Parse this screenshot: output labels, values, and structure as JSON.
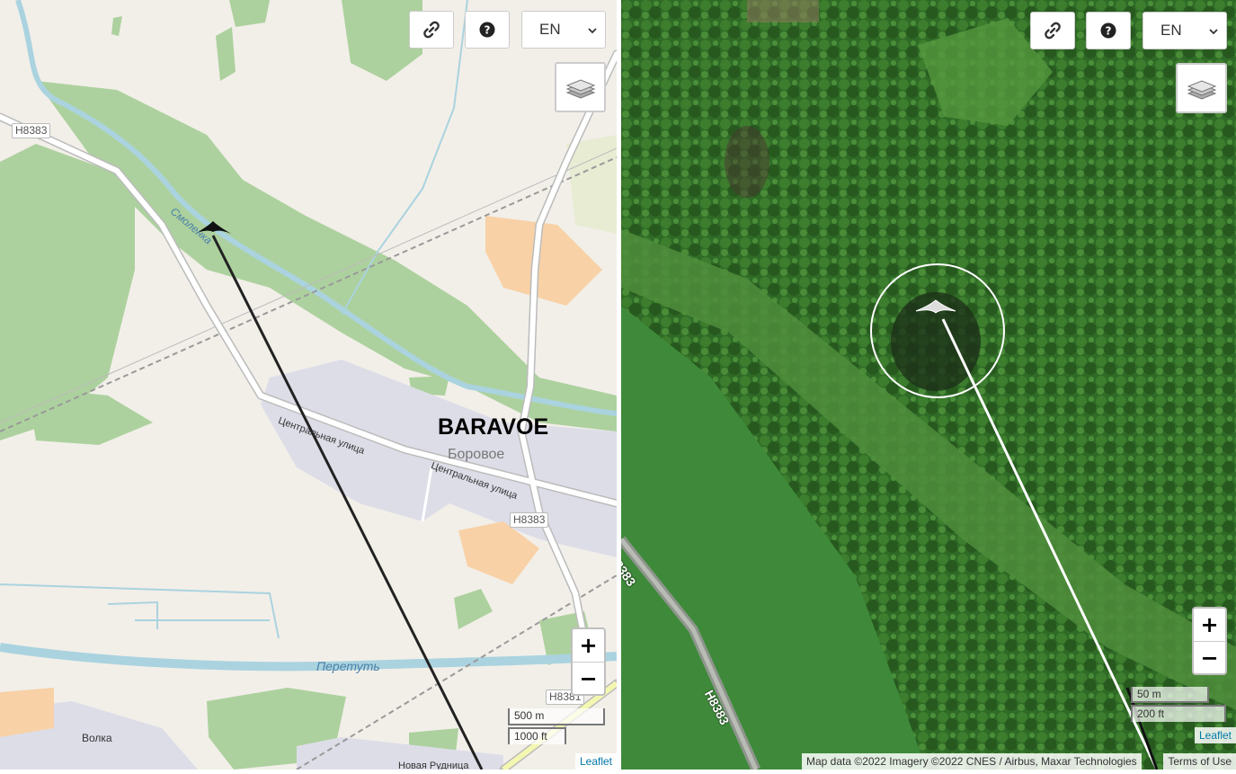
{
  "controls": {
    "left": {
      "lang": "EN",
      "zoom_in": "+",
      "zoom_out": "−"
    },
    "right": {
      "lang": "EN",
      "zoom_in": "+",
      "zoom_out": "−"
    }
  },
  "left_map": {
    "place_label": "BARAVOE",
    "place_label_ru": "Боровое",
    "road_badges": [
      "Н8383",
      "Н8383",
      "Н8381"
    ],
    "street_1": "Центральная улица",
    "street_2": "Центральная улица",
    "river_1": "Смоленка",
    "river_2": "Перетуть",
    "village": "Волка",
    "bottom_street": "Новая Рудница",
    "scale_metric": "500 m",
    "scale_imperial": "1000 ft",
    "attribution": "Leaflet"
  },
  "right_map": {
    "road_label_1": "Н8383",
    "road_label_2": "Н8383",
    "scale_metric": "50 m",
    "scale_imperial": "200 ft",
    "attribution_leaflet": "Leaflet",
    "attribution_data": "Map data ©2022 Imagery ©2022 CNES / Airbus, Maxar Technologies",
    "terms": "Terms of Use"
  },
  "icons": [
    "link-icon",
    "help-icon",
    "chevron-down-icon",
    "layers-icon",
    "plane-marker-icon"
  ],
  "colors": {
    "map_land": "#f2efe9",
    "forest": "#add19e",
    "village": "#dddde8",
    "industrial": "#f8d1a6",
    "river": "#aad3df",
    "satellite_forest": "#2f6b26",
    "satellite_field": "#3e8a3a"
  }
}
